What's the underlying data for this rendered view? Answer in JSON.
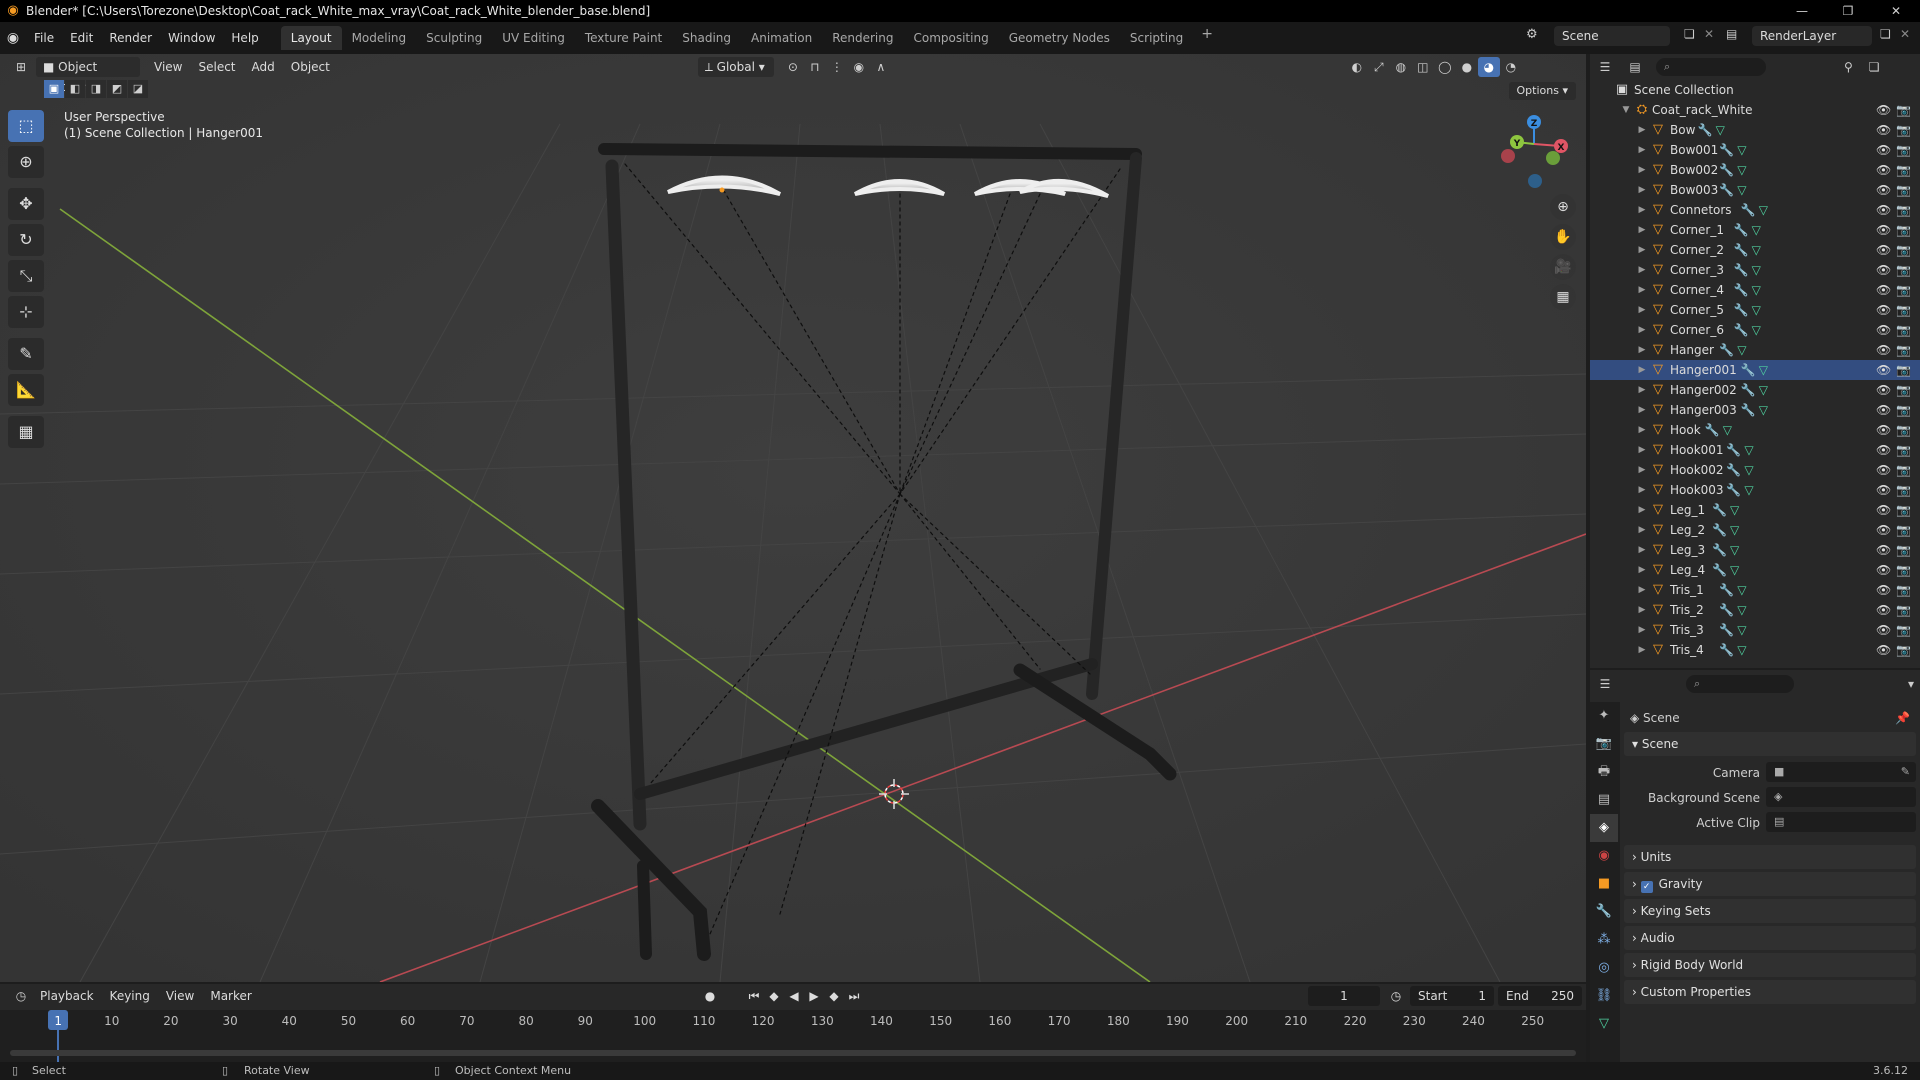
{
  "window": {
    "title": "Blender* [C:\\Users\\Torezone\\Desktop\\Coat_rack_White_max_vray\\Coat_rack_White_blender_base.blend]"
  },
  "menus": [
    "File",
    "Edit",
    "Render",
    "Window",
    "Help"
  ],
  "workspaces": [
    {
      "label": "Layout",
      "active": true
    },
    {
      "label": "Modeling",
      "active": false
    },
    {
      "label": "Sculpting",
      "active": false
    },
    {
      "label": "UV Editing",
      "active": false
    },
    {
      "label": "Texture Paint",
      "active": false
    },
    {
      "label": "Shading",
      "active": false
    },
    {
      "label": "Animation",
      "active": false
    },
    {
      "label": "Rendering",
      "active": false
    },
    {
      "label": "Compositing",
      "active": false
    },
    {
      "label": "Geometry Nodes",
      "active": false
    },
    {
      "label": "Scripting",
      "active": false
    }
  ],
  "workspace_add": "+",
  "scene_selector": "Scene",
  "view_layer": "RenderLayer",
  "viewport": {
    "mode": "Object Mode",
    "menus": [
      "View",
      "Select",
      "Add",
      "Object"
    ],
    "orientation": "Global",
    "perspective": "User Perspective",
    "context": "(1) Scene Collection | Hanger001",
    "options": "Options",
    "gizmo": {
      "x": "X",
      "y": "Y",
      "z": "Z"
    }
  },
  "tools": [
    "select-box",
    "cursor",
    "move",
    "rotate",
    "scale",
    "transform",
    "annotate",
    "measure",
    "add-cube"
  ],
  "outliner": {
    "root": "Scene Collection",
    "collection": "Coat_rack_White",
    "objects": [
      {
        "name": "Bow",
        "selected": false
      },
      {
        "name": "Bow001",
        "selected": false
      },
      {
        "name": "Bow002",
        "selected": false
      },
      {
        "name": "Bow003",
        "selected": false
      },
      {
        "name": "Connetors",
        "selected": false
      },
      {
        "name": "Corner_1",
        "selected": false
      },
      {
        "name": "Corner_2",
        "selected": false
      },
      {
        "name": "Corner_3",
        "selected": false
      },
      {
        "name": "Corner_4",
        "selected": false
      },
      {
        "name": "Corner_5",
        "selected": false
      },
      {
        "name": "Corner_6",
        "selected": false
      },
      {
        "name": "Hanger",
        "selected": false
      },
      {
        "name": "Hanger001",
        "selected": true
      },
      {
        "name": "Hanger002",
        "selected": false
      },
      {
        "name": "Hanger003",
        "selected": false
      },
      {
        "name": "Hook",
        "selected": false
      },
      {
        "name": "Hook001",
        "selected": false
      },
      {
        "name": "Hook002",
        "selected": false
      },
      {
        "name": "Hook003",
        "selected": false
      },
      {
        "name": "Leg_1",
        "selected": false
      },
      {
        "name": "Leg_2",
        "selected": false
      },
      {
        "name": "Leg_3",
        "selected": false
      },
      {
        "name": "Leg_4",
        "selected": false
      },
      {
        "name": "Tris_1",
        "selected": false
      },
      {
        "name": "Tris_2",
        "selected": false
      },
      {
        "name": "Tris_3",
        "selected": false
      },
      {
        "name": "Tris_4",
        "selected": false
      }
    ]
  },
  "properties": {
    "context": "Scene",
    "panel_scene": "Scene",
    "fields": [
      {
        "label": "Camera",
        "value": ""
      },
      {
        "label": "Background Scene",
        "value": ""
      },
      {
        "label": "Active Clip",
        "value": ""
      }
    ],
    "panels": [
      {
        "label": "Units",
        "checkbox": false
      },
      {
        "label": "Gravity",
        "checkbox": true
      },
      {
        "label": "Keying Sets",
        "checkbox": false
      },
      {
        "label": "Audio",
        "checkbox": false
      },
      {
        "label": "Rigid Body World",
        "checkbox": false
      },
      {
        "label": "Custom Properties",
        "checkbox": false
      }
    ]
  },
  "timeline": {
    "menus": [
      "Playback",
      "Keying",
      "View",
      "Marker"
    ],
    "current_frame": "1",
    "start_label": "Start",
    "start": "1",
    "end_label": "End",
    "end": "250",
    "frames": [
      "1",
      "10",
      "20",
      "30",
      "40",
      "50",
      "60",
      "70",
      "80",
      "90",
      "100",
      "110",
      "120",
      "130",
      "140",
      "150",
      "160",
      "170",
      "180",
      "190",
      "200",
      "210",
      "220",
      "230",
      "240",
      "250"
    ]
  },
  "statusbar": {
    "select": "Select",
    "rotate": "Rotate View",
    "context_menu": "Object Context Menu",
    "version": "3.6.12"
  },
  "colors": {
    "accent": "#4772b3",
    "x_axis": "#e05565",
    "y_axis": "#8ec63f",
    "z_axis": "#3b8ee0",
    "object_orange": "#f59a23",
    "mesh_green": "#4fd1a0"
  }
}
